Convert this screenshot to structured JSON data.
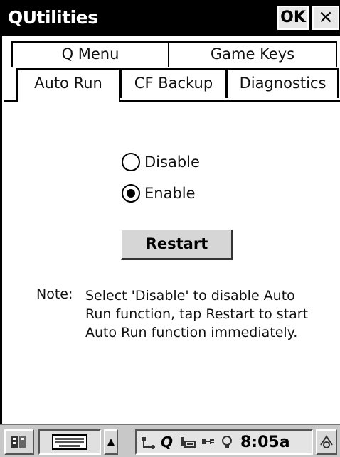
{
  "window": {
    "title": "QUtilities",
    "ok_label": "OK",
    "close_label": "×"
  },
  "tabs": {
    "row1": [
      {
        "label": "Q Menu"
      },
      {
        "label": "Game Keys"
      }
    ],
    "row2": [
      {
        "label": "Auto Run",
        "active": true
      },
      {
        "label": "CF Backup",
        "active": false
      },
      {
        "label": "Diagnostics",
        "active": false
      }
    ]
  },
  "auto_run": {
    "options": [
      {
        "label": "Disable",
        "selected": false
      },
      {
        "label": "Enable",
        "selected": true
      }
    ],
    "restart_label": "Restart",
    "note_label": "Note:",
    "note_text": "Select 'Disable' to disable Auto Run function, tap Restart to start Auto Run function immediately."
  },
  "taskbar": {
    "start_icon": "start-menu-icon",
    "keyboard_icon": "keyboard-icon",
    "up_arrow": "▲",
    "tray_icons": [
      "network-icon",
      "q-icon",
      "sync-icon",
      "power-icon",
      "lightbulb-icon"
    ],
    "clock": "8:05a",
    "desktop_icon": "desktop-icon"
  }
}
